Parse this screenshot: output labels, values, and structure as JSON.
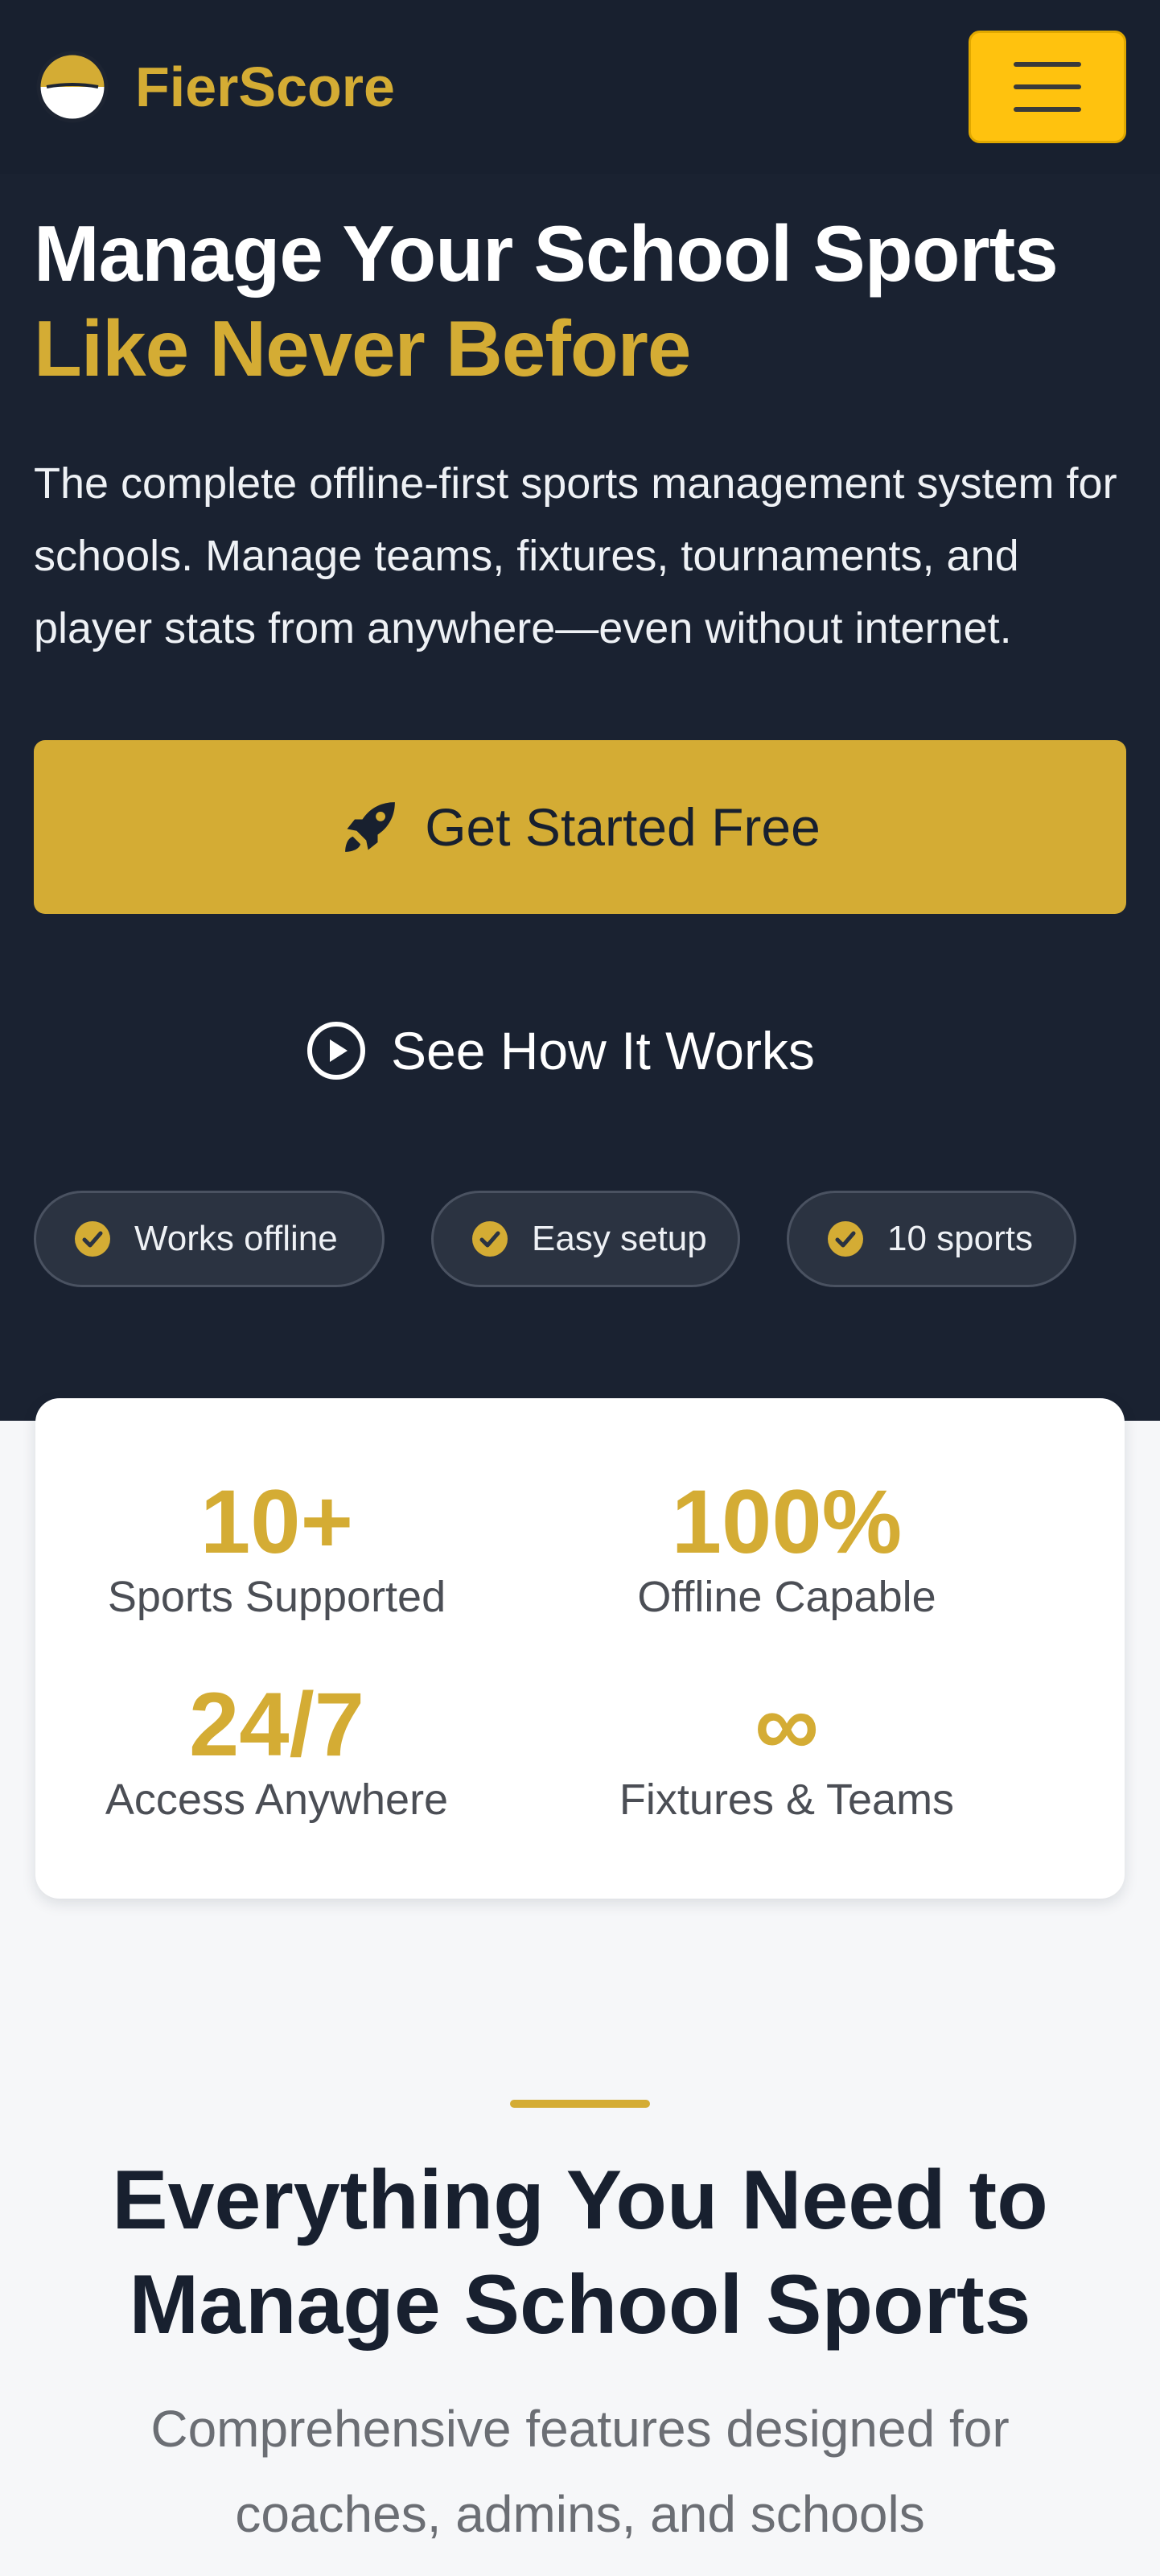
{
  "brand": {
    "name": "FierScore",
    "logo_icon": "half-sun-circle-icon",
    "accent_color": "#d4ac34"
  },
  "nav": {
    "menu_icon": "hamburger-menu-icon",
    "menu_button_color": "#ffc20e"
  },
  "hero": {
    "title_line1": "Manage Your School Sports",
    "title_line2": "Like Never Before",
    "description": "The complete offline-first sports management system for schools. Manage teams, fixtures, tournaments, and player stats from anywhere—even without internet.",
    "primary_cta": {
      "label": "Get Started Free",
      "icon": "rocket-icon"
    },
    "secondary_cta": {
      "label": "See How It Works",
      "icon": "play-circle-icon"
    },
    "badges": [
      {
        "label": "Works offline",
        "icon": "check-circle-icon"
      },
      {
        "label": "Easy setup",
        "icon": "check-circle-icon"
      },
      {
        "label": "10 sports",
        "icon": "check-circle-icon"
      }
    ]
  },
  "stats": [
    {
      "value": "10+",
      "label": "Sports Supported"
    },
    {
      "value": "100%",
      "label": "Offline Capable"
    },
    {
      "value": "24/7",
      "label": "Access Anywhere"
    },
    {
      "value": "∞",
      "label": "Fixtures & Teams"
    }
  ],
  "features": {
    "title": "Everything You Need to Manage School Sports",
    "subtitle": "Comprehensive features designed for coaches, admins, and schools"
  }
}
